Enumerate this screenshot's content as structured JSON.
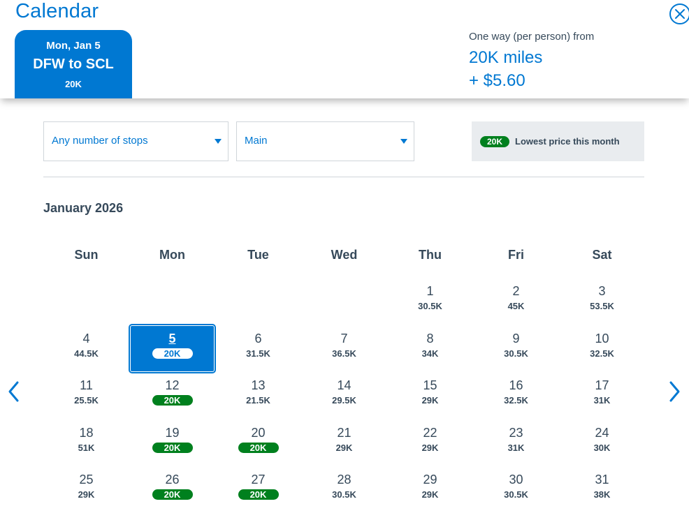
{
  "header": {
    "title": "Calendar",
    "close_icon": "close-circle-icon",
    "flight": {
      "date": "Mon, Jan 5",
      "route": "DFW to SCL",
      "price": "20K"
    },
    "fare": {
      "label": "One way (per person) from",
      "miles": "20K miles",
      "cash": "+ $5.60"
    }
  },
  "filters": {
    "stops": "Any number of stops",
    "cabin": "Main",
    "legend_pill": "20K",
    "legend_text": "Lowest price this month"
  },
  "month": "January 2026",
  "weekdays": [
    "Sun",
    "Mon",
    "Tue",
    "Wed",
    "Thu",
    "Fri",
    "Sat"
  ],
  "weeks": [
    [
      null,
      null,
      null,
      null,
      {
        "day": "1",
        "price": "30.5K",
        "low": false
      },
      {
        "day": "2",
        "price": "45K",
        "low": false
      },
      {
        "day": "3",
        "price": "53.5K",
        "low": false
      }
    ],
    [
      {
        "day": "4",
        "price": "44.5K",
        "low": false
      },
      {
        "day": "5",
        "price": "20K",
        "low": true,
        "selected": true
      },
      {
        "day": "6",
        "price": "31.5K",
        "low": false
      },
      {
        "day": "7",
        "price": "36.5K",
        "low": false
      },
      {
        "day": "8",
        "price": "34K",
        "low": false
      },
      {
        "day": "9",
        "price": "30.5K",
        "low": false
      },
      {
        "day": "10",
        "price": "32.5K",
        "low": false
      }
    ],
    [
      {
        "day": "11",
        "price": "25.5K",
        "low": false
      },
      {
        "day": "12",
        "price": "20K",
        "low": true
      },
      {
        "day": "13",
        "price": "21.5K",
        "low": false
      },
      {
        "day": "14",
        "price": "29.5K",
        "low": false
      },
      {
        "day": "15",
        "price": "29K",
        "low": false
      },
      {
        "day": "16",
        "price": "32.5K",
        "low": false
      },
      {
        "day": "17",
        "price": "31K",
        "low": false
      }
    ],
    [
      {
        "day": "18",
        "price": "51K",
        "low": false
      },
      {
        "day": "19",
        "price": "20K",
        "low": true
      },
      {
        "day": "20",
        "price": "20K",
        "low": true
      },
      {
        "day": "21",
        "price": "29K",
        "low": false
      },
      {
        "day": "22",
        "price": "29K",
        "low": false
      },
      {
        "day": "23",
        "price": "31K",
        "low": false
      },
      {
        "day": "24",
        "price": "30K",
        "low": false
      }
    ],
    [
      {
        "day": "25",
        "price": "29K",
        "low": false
      },
      {
        "day": "26",
        "price": "20K",
        "low": true
      },
      {
        "day": "27",
        "price": "20K",
        "low": true
      },
      {
        "day": "28",
        "price": "30.5K",
        "low": false
      },
      {
        "day": "29",
        "price": "29K",
        "low": false
      },
      {
        "day": "30",
        "price": "30.5K",
        "low": false
      },
      {
        "day": "31",
        "price": "38K",
        "low": false
      }
    ]
  ],
  "nav": {
    "prev_icon": "chevron-left-icon",
    "next_icon": "chevron-right-icon"
  },
  "colors": {
    "brand_blue": "#0078d2",
    "low_green": "#00801e",
    "text": "#36495a",
    "legend_bg": "#e9ecef"
  }
}
